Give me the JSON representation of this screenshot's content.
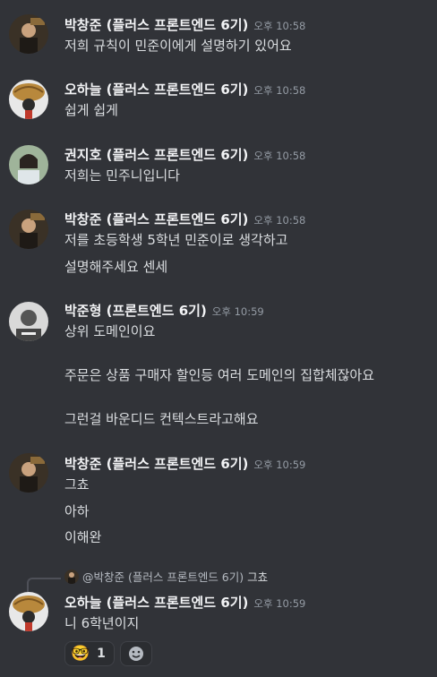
{
  "messages": [
    {
      "author": "박창준 (플러스 프론트엔드 6기)",
      "time": "오후 10:58",
      "lines": [
        "저희 규칙이 민준이에게 설명하기 있어요"
      ]
    },
    {
      "author": "오하늘 (플러스 프론트엔드 6기)",
      "time": "오후 10:58",
      "lines": [
        "쉽게 쉽게"
      ]
    },
    {
      "author": "권지호 (플러스 프론트엔드 6기)",
      "time": "오후 10:58",
      "lines": [
        "저희는 민주니입니다"
      ]
    },
    {
      "author": "박창준 (플러스 프론트엔드 6기)",
      "time": "오후 10:58",
      "lines": [
        "저를 초등학생 5학년 민준이로 생각하고",
        "설명해주세요 센세"
      ]
    },
    {
      "author": "박준형 (프론트엔드 6기)",
      "time": "오후 10:59",
      "lines": [
        "상위 도메인이요",
        "주문은 상품 구매자 할인등 여러 도메인의 집합체잖아요",
        "그런걸 바운디드 컨텍스트라고해요"
      ]
    },
    {
      "author": "박창준 (플러스 프론트엔드 6기)",
      "time": "오후 10:59",
      "lines": [
        "그쵸",
        "아하",
        "이해완"
      ]
    },
    {
      "author": "오하늘 (플러스 프론트엔드 6기)",
      "time": "오후 10:59",
      "lines": [
        "니 6학년이지"
      ]
    }
  ],
  "reply": {
    "mention": "@박창준 (플러스 프론트엔드 6기)",
    "text": "그쵸"
  },
  "reactions": [
    {
      "emoji": "🤓",
      "count": "1"
    },
    {
      "emoji": "add-reaction-icon"
    }
  ],
  "colors": {
    "background": "#313338",
    "name": "#f2f3f5",
    "text": "#dbdee1",
    "timestamp": "#949ba4"
  }
}
